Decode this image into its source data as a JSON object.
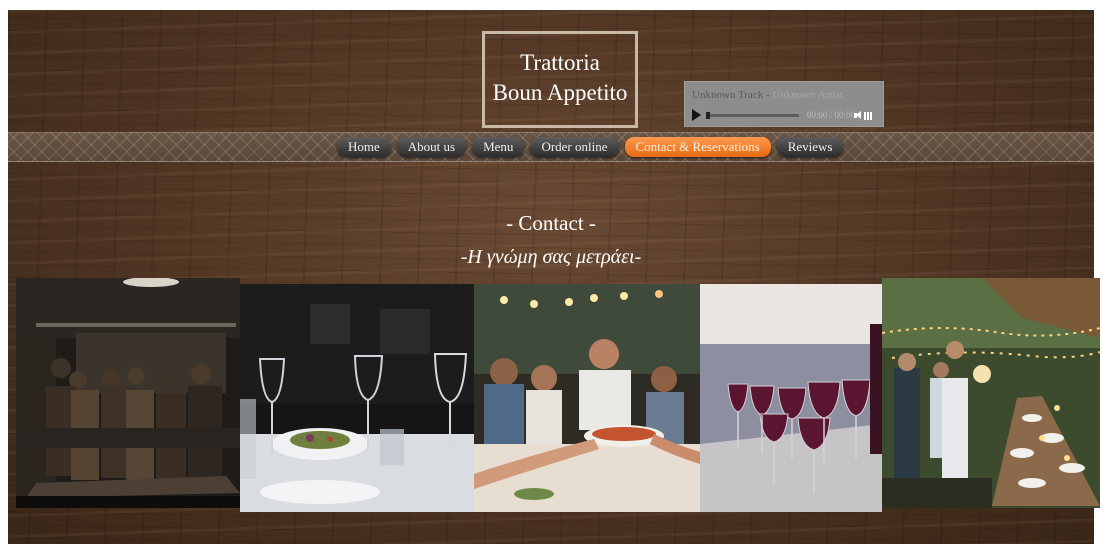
{
  "header": {
    "logo_line1": "Trattoria",
    "logo_line2": "Boun Appetito"
  },
  "player": {
    "track": "Unknown Track",
    "separator": " - ",
    "artist": "Unknown Artist",
    "time": "00:00 / 00:00",
    "progress": 0
  },
  "nav": {
    "items": [
      {
        "label": "Home"
      },
      {
        "label": "About us"
      },
      {
        "label": "Menu"
      },
      {
        "label": "Order online"
      },
      {
        "label": "Contact & Reservations",
        "active": true
      },
      {
        "label": "Reviews"
      }
    ]
  },
  "content": {
    "title": "- Contact -",
    "subtitle": "-Η γνώμη σας μετράει-"
  },
  "photos": [
    {
      "icon": "restaurant-kitchen-photo"
    },
    {
      "icon": "wine-glasses-table-photo"
    },
    {
      "icon": "friends-dinner-photo"
    },
    {
      "icon": "red-wine-glasses-photo"
    },
    {
      "icon": "outdoor-dining-photo"
    }
  ],
  "colors": {
    "accent": "#f07a22",
    "nav_bg": "#3a3a3a",
    "wood": "#4e3422"
  }
}
